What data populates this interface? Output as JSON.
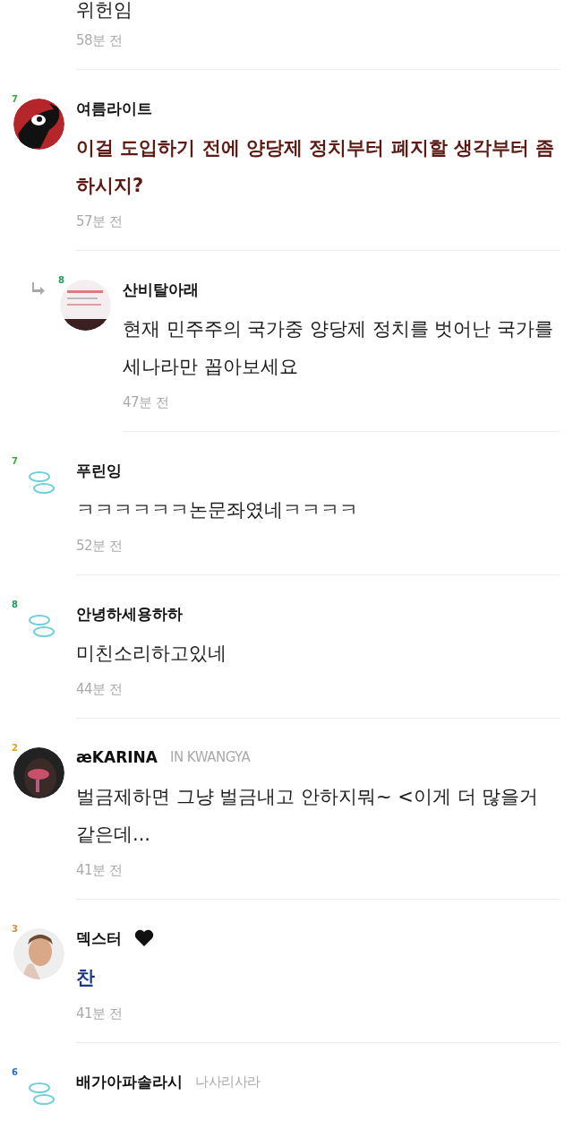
{
  "comments": [
    {
      "reply": false,
      "body": {
        "text": "위헌임"
      },
      "time": "58분 전"
    },
    {
      "reply": false,
      "name": "여름라이트",
      "badge": {
        "text": "7",
        "color": "#3cae3c"
      },
      "body": {
        "text": "이걸 도입하기 전에 양당제 정치부터 폐지할 생각부터 좀 하시지?",
        "color": "#5c1a12"
      },
      "time": "57분 전"
    },
    {
      "reply": true,
      "name": "산비탈아래",
      "badge": {
        "text": "8",
        "color": "#1f9a5a"
      },
      "body": {
        "text": "현재 민주주의 국가중 양당제 정치를 벗어난 국가를 세나라만 꼽아보세요"
      },
      "time": "47분 전"
    },
    {
      "reply": false,
      "name": "푸린잉",
      "badge": {
        "text": "7",
        "color": "#3cae3c"
      },
      "avatar": {
        "kind": "default"
      },
      "body": {
        "text": "ㅋㅋㅋㅋㅋㅋ논문좌였네ㅋㅋㅋㅋ"
      },
      "time": "52분 전"
    },
    {
      "reply": false,
      "name": "안녕하세용하하",
      "badge": {
        "text": "8",
        "color": "#1f9a5a"
      },
      "avatar": {
        "kind": "default"
      },
      "body": {
        "text": "미친소리하고있네"
      },
      "time": "44분 전"
    },
    {
      "reply": false,
      "name": "æKARINA",
      "tag": "IN KWANGYA",
      "badge": {
        "text": "2",
        "color": "#e0a020"
      },
      "body": {
        "text": "벌금제하면 그냥 벌금내고 안하지뭐~ <이게 더 많을거 같은데..."
      },
      "time": "41분 전"
    },
    {
      "reply": false,
      "name": "덱스터",
      "heart": true,
      "badge": {
        "text": "3",
        "color": "#e08a30"
      },
      "body": {
        "text": "찬",
        "color": "#1d3a8a"
      },
      "time": "41분 전"
    },
    {
      "reply": false,
      "name": "배가아파솔라시",
      "tag": "나사리사라",
      "badge": {
        "text": "6",
        "color": "#2a6fc0"
      },
      "avatar": {
        "kind": "default"
      }
    }
  ]
}
